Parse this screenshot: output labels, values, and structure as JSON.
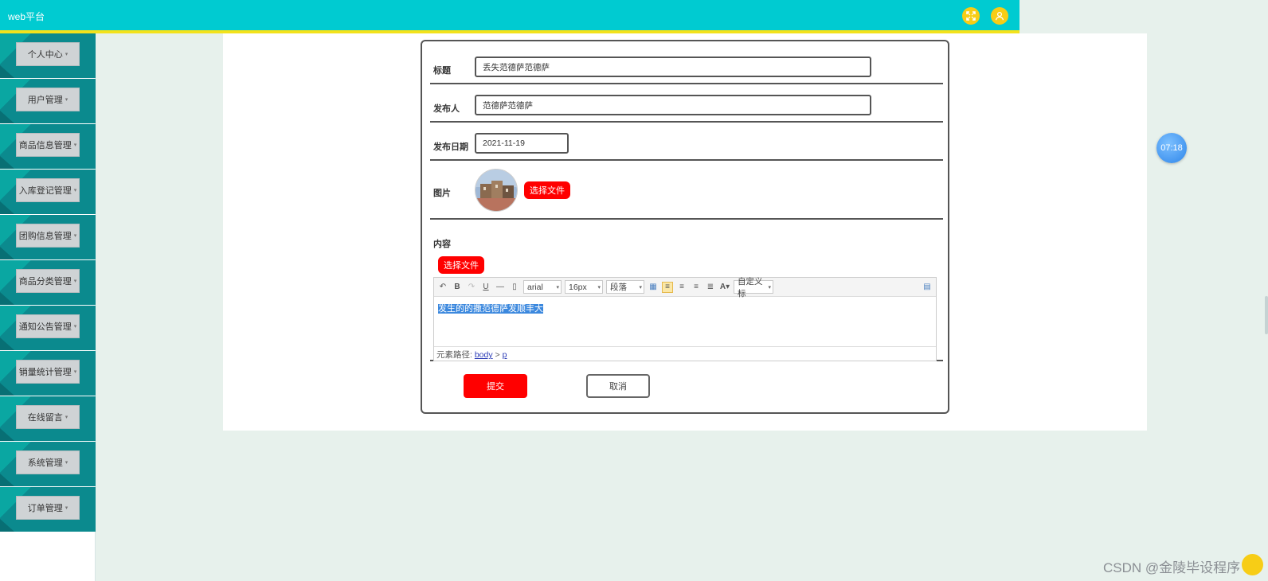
{
  "header": {
    "title": "web平台",
    "fullscreen_icon": "fullscreen-icon",
    "user_icon": "user-icon",
    "colors": {
      "bar": "#00cbd1",
      "underline": "#f3e21b",
      "icon_bg": "#f7cd16"
    }
  },
  "sidebar": {
    "items": [
      {
        "label": "个人中心"
      },
      {
        "label": "用户管理"
      },
      {
        "label": "商品信息管理"
      },
      {
        "label": "入库登记管理"
      },
      {
        "label": "团购信息管理"
      },
      {
        "label": "商品分类管理"
      },
      {
        "label": "通知公告管理"
      },
      {
        "label": "销量统计管理"
      },
      {
        "label": "在线留言"
      },
      {
        "label": "系统管理"
      },
      {
        "label": "订单管理"
      }
    ],
    "caret": "▾"
  },
  "form": {
    "title_label": "标题",
    "title_value": "丢失范德萨范德萨",
    "publisher_label": "发布人",
    "publisher_value": "范德萨范德萨",
    "date_label": "发布日期",
    "date_value": "2021-11-19",
    "image_label": "图片",
    "image_upload": "选择文件",
    "content_label": "内容",
    "content_upload": "选择文件",
    "submit": "提交",
    "cancel": "取消"
  },
  "editor": {
    "font_family": "arial",
    "font_size": "16px",
    "paragraph": "段落",
    "custom_title": "自定义标",
    "content": "发生的的撒范德萨发顺丰大",
    "path_label": "元素路径:",
    "path_body": "body",
    "path_sep": ">",
    "path_p": "p"
  },
  "clock": {
    "time": "07:18"
  },
  "watermark": {
    "text": "CSDN @金陵毕设程序"
  },
  "colors": {
    "accent_red": "#ff0000",
    "background": "#e7f1ec",
    "sidebar_teal": "#0b8a8e"
  }
}
